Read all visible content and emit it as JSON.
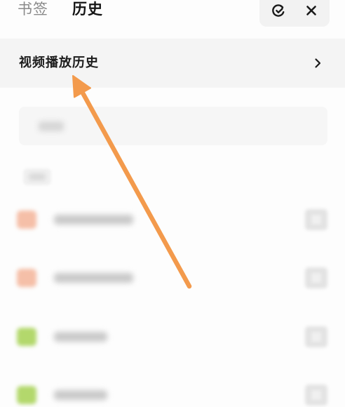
{
  "tabs": [
    {
      "label": "书签",
      "active": false
    },
    {
      "label": "历史",
      "active": true
    }
  ],
  "actions": {
    "sync_icon": "sync-check-icon",
    "close_icon": "close-icon"
  },
  "video_history": {
    "label": "视频播放历史",
    "icon": "chevron-right-icon"
  },
  "search": {
    "icon": "none"
  },
  "history_list": {
    "items": [
      {
        "favicon_color": "#F5BFA8"
      },
      {
        "favicon_color": "#F5BFA8"
      },
      {
        "favicon_color": "#B3D86C"
      },
      {
        "favicon_color": "#B3D86C"
      }
    ]
  },
  "annotation": {
    "icon": "arrow-annotation",
    "arrow_color": "#F39A4C"
  },
  "colors": {
    "tab_inactive": "#8A8A8A",
    "tab_active": "#151515",
    "row_background": "#F4F4F4",
    "page_background": "#FDFDFD"
  }
}
